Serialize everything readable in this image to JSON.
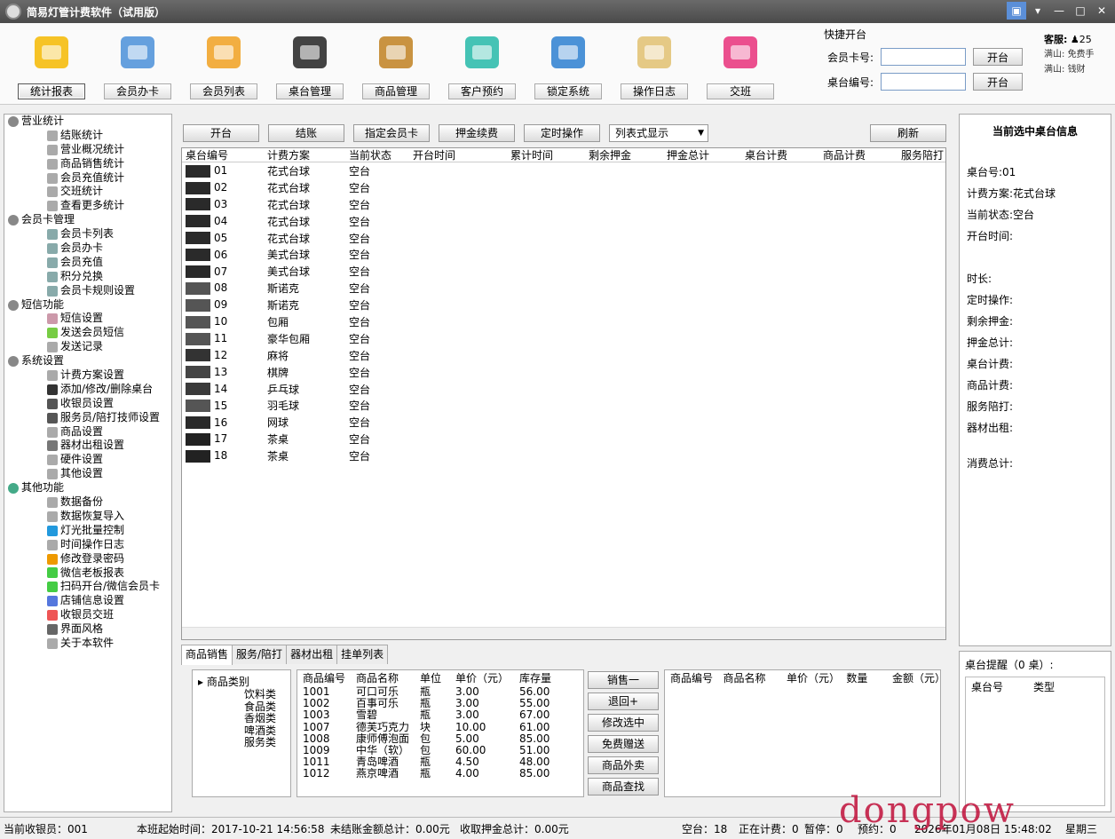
{
  "window": {
    "title": "简易灯管计费软件（试用版）"
  },
  "toolbar": [
    {
      "label": "统计报表",
      "icon": "bar-chart-icon",
      "color": "#f5b800"
    },
    {
      "label": "会员办卡",
      "icon": "member-add-icon",
      "color": "#4a8fd8"
    },
    {
      "label": "会员列表",
      "icon": "members-icon",
      "color": "#f0a020"
    },
    {
      "label": "桌台管理",
      "icon": "table-manage-icon",
      "color": "#222"
    },
    {
      "label": "商品管理",
      "icon": "goods-gear-icon",
      "color": "#c08020"
    },
    {
      "label": "客户预约",
      "icon": "alarm-clock-icon",
      "color": "#25b8a8"
    },
    {
      "label": "锁定系统",
      "icon": "lock-icon",
      "color": "#2b7fd0"
    },
    {
      "label": "操作日志",
      "icon": "log-icon",
      "color": "#e0c070"
    },
    {
      "label": "交班",
      "icon": "shift-icon",
      "color": "#e8307a"
    }
  ],
  "quick": {
    "title": "快捷开台",
    "card_label": "会员卡号:",
    "table_label": "桌台编号:",
    "open_label": "开台",
    "card_value": "",
    "table_value": ""
  },
  "service": {
    "label": "客服:",
    "v1": "25",
    "l1": "满山:",
    "v1b": "免费手",
    "l2": "满山:",
    "v2b": "钱财"
  },
  "tree": [
    {
      "t": "g",
      "label": "营业统计",
      "color": "#888"
    },
    {
      "t": "c",
      "label": "结账统计",
      "color": "#aaa"
    },
    {
      "t": "c",
      "label": "营业概况统计",
      "color": "#aaa"
    },
    {
      "t": "c",
      "label": "商品销售统计",
      "color": "#aaa"
    },
    {
      "t": "c",
      "label": "会员充值统计",
      "color": "#aaa"
    },
    {
      "t": "c",
      "label": "交班统计",
      "color": "#aaa"
    },
    {
      "t": "c",
      "label": "查看更多统计",
      "color": "#aaa"
    },
    {
      "t": "g",
      "label": "会员卡管理",
      "color": "#888"
    },
    {
      "t": "c",
      "label": "会员卡列表",
      "color": "#8aa"
    },
    {
      "t": "c",
      "label": "会员办卡",
      "color": "#8aa"
    },
    {
      "t": "c",
      "label": "会员充值",
      "color": "#8aa"
    },
    {
      "t": "c",
      "label": "积分兑换",
      "color": "#8aa"
    },
    {
      "t": "c",
      "label": "会员卡规则设置",
      "color": "#8aa"
    },
    {
      "t": "g",
      "label": "短信功能",
      "color": "#888"
    },
    {
      "t": "c",
      "label": "短信设置",
      "color": "#c9a"
    },
    {
      "t": "c",
      "label": "发送会员短信",
      "color": "#7c4"
    },
    {
      "t": "c",
      "label": "发送记录",
      "color": "#aaa"
    },
    {
      "t": "g",
      "label": "系统设置",
      "color": "#888"
    },
    {
      "t": "c",
      "label": "计费方案设置",
      "color": "#aaa"
    },
    {
      "t": "c",
      "label": "添加/修改/删除桌台",
      "color": "#333"
    },
    {
      "t": "c",
      "label": "收银员设置",
      "color": "#555"
    },
    {
      "t": "c",
      "label": "服务员/陪打技师设置",
      "color": "#555"
    },
    {
      "t": "c",
      "label": "商品设置",
      "color": "#aaa"
    },
    {
      "t": "c",
      "label": "器材出租设置",
      "color": "#777"
    },
    {
      "t": "c",
      "label": "硬件设置",
      "color": "#aaa"
    },
    {
      "t": "c",
      "label": "其他设置",
      "color": "#aaa"
    },
    {
      "t": "g",
      "label": "其他功能",
      "color": "#4a8"
    },
    {
      "t": "c",
      "label": "数据备份",
      "color": "#aaa"
    },
    {
      "t": "c",
      "label": "数据恢复导入",
      "color": "#aaa"
    },
    {
      "t": "c",
      "label": "灯光批量控制",
      "color": "#29d"
    },
    {
      "t": "c",
      "label": "时间操作日志",
      "color": "#aaa"
    },
    {
      "t": "c",
      "label": "修改登录密码",
      "color": "#e90"
    },
    {
      "t": "c",
      "label": "微信老板报表",
      "color": "#4c4"
    },
    {
      "t": "c",
      "label": "扫码开台/微信会员卡",
      "color": "#4c4"
    },
    {
      "t": "c",
      "label": "店铺信息设置",
      "color": "#57d"
    },
    {
      "t": "c",
      "label": "收银员交班",
      "color": "#e55"
    },
    {
      "t": "c",
      "label": "界面风格",
      "color": "#666"
    },
    {
      "t": "c",
      "label": "关于本软件",
      "color": "#aaa"
    }
  ],
  "actions": {
    "open": "开台",
    "checkout": "结账",
    "assign_card": "指定会员卡",
    "deposit": "押金续费",
    "timer": "定时操作",
    "view_mode": "列表式显示",
    "refresh": "刷新"
  },
  "grid": {
    "headers": [
      "桌台编号",
      "计费方案",
      "当前状态",
      "开台时间",
      "累计时间",
      "剩余押金",
      "押金总计",
      "桌台计费",
      "商品计费",
      "服务陪打"
    ],
    "rows": [
      {
        "no": "01",
        "plan": "花式台球",
        "status": "空台",
        "icon": "table-dark"
      },
      {
        "no": "02",
        "plan": "花式台球",
        "status": "空台",
        "icon": "table-dark"
      },
      {
        "no": "03",
        "plan": "花式台球",
        "status": "空台",
        "icon": "table-dark"
      },
      {
        "no": "04",
        "plan": "花式台球",
        "status": "空台",
        "icon": "table-dark"
      },
      {
        "no": "05",
        "plan": "花式台球",
        "status": "空台",
        "icon": "table-dark"
      },
      {
        "no": "06",
        "plan": "美式台球",
        "status": "空台",
        "icon": "table-dark"
      },
      {
        "no": "07",
        "plan": "美式台球",
        "status": "空台",
        "icon": "table-dark"
      },
      {
        "no": "08",
        "plan": "斯诺克",
        "status": "空台",
        "icon": "table-gray"
      },
      {
        "no": "09",
        "plan": "斯诺克",
        "status": "空台",
        "icon": "table-gray"
      },
      {
        "no": "10",
        "plan": "包厢",
        "status": "空台",
        "icon": "table-gray"
      },
      {
        "no": "11",
        "plan": "豪华包厢",
        "status": "空台",
        "icon": "table-gray"
      },
      {
        "no": "12",
        "plan": "麻将",
        "status": "空台",
        "icon": "mahjong"
      },
      {
        "no": "13",
        "plan": "棋牌",
        "status": "空台",
        "icon": "card"
      },
      {
        "no": "14",
        "plan": "乒乓球",
        "status": "空台",
        "icon": "pingpong"
      },
      {
        "no": "15",
        "plan": "羽毛球",
        "status": "空台",
        "icon": "table-gray"
      },
      {
        "no": "16",
        "plan": "网球",
        "status": "空台",
        "icon": "table-dark"
      },
      {
        "no": "17",
        "plan": "茶桌",
        "status": "空台",
        "icon": "tea"
      },
      {
        "no": "18",
        "plan": "茶桌",
        "status": "空台",
        "icon": "tea"
      }
    ]
  },
  "info": {
    "title": "当前选中桌台信息",
    "table_no_label": "桌台号:",
    "table_no": "01",
    "plan_label": "计费方案:",
    "plan": "花式台球",
    "status_label": "当前状态:",
    "status": "空台",
    "start_label": "开台时间:",
    "duration_label": "时长:",
    "timer_label": "定时操作:",
    "remain_label": "剩余押金:",
    "deposit_label": "押金总计:",
    "table_fee_label": "桌台计费:",
    "goods_fee_label": "商品计费:",
    "service_label": "服务陪打:",
    "rent_label": "器材出租:",
    "total_label": "消费总计:"
  },
  "tip": {
    "title": "桌台提醒（0 桌）:",
    "col1": "桌台号",
    "col2": "类型"
  },
  "tabs": [
    "商品销售",
    "服务/陪打",
    "器材出租",
    "挂单列表"
  ],
  "categories": {
    "root": "商品类别",
    "items": [
      "饮料类",
      "食品类",
      "香烟类",
      "啤酒类",
      "服务类"
    ]
  },
  "goods": {
    "headers": [
      "商品编号",
      "商品名称",
      "单位",
      "单价（元）",
      "库存量"
    ],
    "rows": [
      [
        "1001",
        "可口可乐",
        "瓶",
        "3.00",
        "56.00"
      ],
      [
        "1002",
        "百事可乐",
        "瓶",
        "3.00",
        "55.00"
      ],
      [
        "1003",
        "雪碧",
        "瓶",
        "3.00",
        "67.00"
      ],
      [
        "1007",
        "德芙巧克力",
        "块",
        "10.00",
        "61.00"
      ],
      [
        "1008",
        "康师傅泡面",
        "包",
        "5.00",
        "85.00"
      ],
      [
        "1009",
        "中华（软）",
        "包",
        "60.00",
        "51.00"
      ],
      [
        "1011",
        "青岛啤酒",
        "瓶",
        "4.50",
        "48.00"
      ],
      [
        "1012",
        "燕京啤酒",
        "瓶",
        "4.00",
        "85.00"
      ]
    ]
  },
  "goods_buttons": [
    "销售一",
    "退回+",
    "修改选中",
    "免费赠送",
    "商品外卖",
    "商品查找"
  ],
  "cart": {
    "headers": [
      "商品编号",
      "商品名称",
      "单价（元）",
      "数量",
      "金额（元）"
    ]
  },
  "status": {
    "cashier": "当前收银员：001",
    "start": "本班起始时间：2017-10-21 14:56:58",
    "unpaid": "未结账金额总计：0.00元",
    "deposit": "收取押金总计：0.00元",
    "free": "空台：18",
    "billing": "正在计费：0",
    "paused": "暂停：0",
    "booked": "预约：0",
    "datetime": "2026年01月08日 15:48:02",
    "weekday": "星期三"
  },
  "watermark": "dongpow .com"
}
